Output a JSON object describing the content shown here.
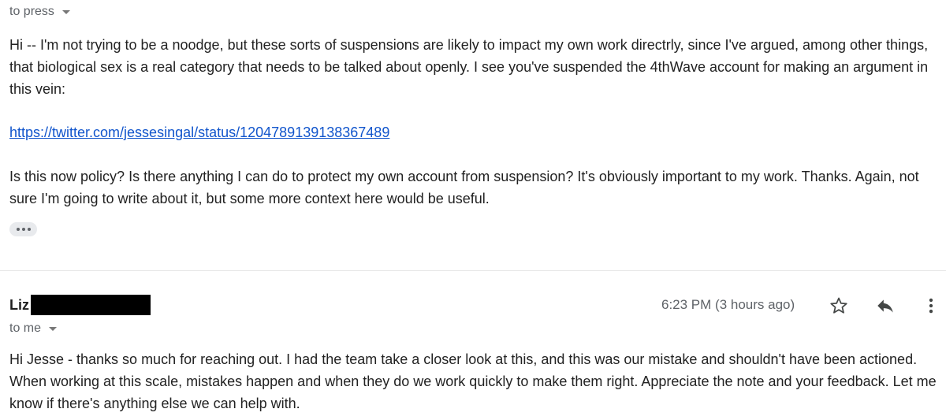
{
  "message1": {
    "recipient_label": "to press",
    "paragraph1": "Hi -- I'm not trying to be a noodge, but these sorts of suspensions are likely to impact my own work directrly, since I've argued, among other things, that biological sex is a real category that needs to be talked about openly. I see you've suspended the 4thWave account for making an argument in this vein:",
    "link_text": "https://twitter.com/jessesingal/status/1204789139138367489",
    "paragraph2": "Is this now policy? Is there anything I can do to protect my own account from suspension? It's obviously important to my work. Thanks. Again, not sure I'm going to write about it, but some more context here would be useful.",
    "show_trimmed_icon": "ellipsis-icon"
  },
  "message2": {
    "sender_name": "Liz",
    "recipient_label": "to me",
    "timestamp": "6:23 PM (3 hours ago)",
    "body": "Hi Jesse - thanks so much for reaching out. I had the team take a closer look at this, and this was our mistake and shouldn't have been actioned. When working at this scale, mistakes happen and when they do we work quickly to make them right. Appreciate the note and your feedback. Let me know if there's anything else we can help with.",
    "icons": {
      "star": "star-icon",
      "reply": "reply-icon",
      "more": "more-vertical-icon"
    }
  },
  "colors": {
    "text": "#222222",
    "muted": "#5f6368",
    "link": "#1155cc",
    "divider": "#e6e6e6",
    "redaction": "#000000"
  }
}
